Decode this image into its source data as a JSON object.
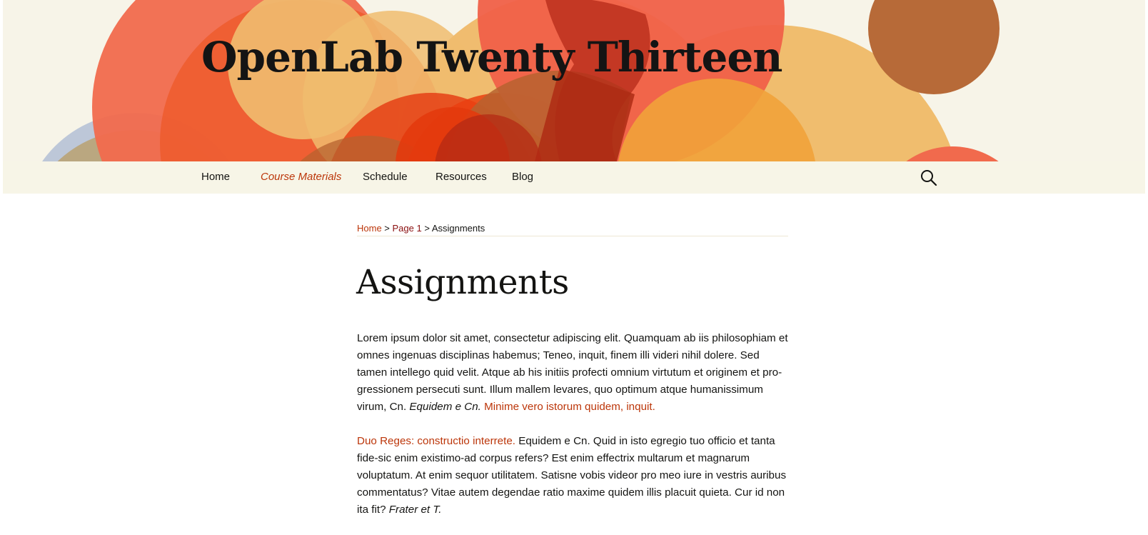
{
  "site": {
    "title": "OpenLab Twenty Thirteen"
  },
  "nav": {
    "items": [
      {
        "label": "Home",
        "current": false
      },
      {
        "label": "Course Materials",
        "current": true
      },
      {
        "label": "Schedule",
        "current": false
      },
      {
        "label": "Resources",
        "current": false
      },
      {
        "label": "Blog",
        "current": false
      }
    ],
    "search_icon": "search-icon"
  },
  "breadcrumb": {
    "home": "Home",
    "sep1": " > ",
    "page1": "Page 1",
    "sep2": " > ",
    "current": "Assignments"
  },
  "page": {
    "title": "Assignments",
    "p1": {
      "text": "Lorem ipsum dolor sit amet, consectetur adipiscing elit. Quamquam ab iis philosophiam et omnes ingenuas disciplinas habemus; Teneo, inquit, finem illi videri nihil dolere. Sed tamen intellego quid velit. Atque ab his initiis profecti omnium virtutum et originem et pro­gressionem persecuti sunt. Illum mallem levares, quo optimum atque humanissimum virum, Cn. ",
      "em": "Equidem e Cn.",
      "space": " ",
      "link": "Minime vero istorum quidem, inquit."
    },
    "p2": {
      "link": "Duo Reges: constructio interrete.",
      "text": " Equidem e Cn. Quid in isto egregio tuo officio et tanta fide-sic enim existimo-ad corpus refers? Est enim effectrix multarum et magnarum volupta­tum. At enim sequor utilitatem. Satisne vobis videor pro meo iure in vestris auribus com­mentatus? Vitae autem degendae ratio maxime quidem illis placuit quieta. Cur id non ita fit? ",
      "em": "Frater et T."
    }
  },
  "colors": {
    "accent": "#bc360a",
    "header_bg": "#f7f4e8",
    "text": "#141412"
  }
}
